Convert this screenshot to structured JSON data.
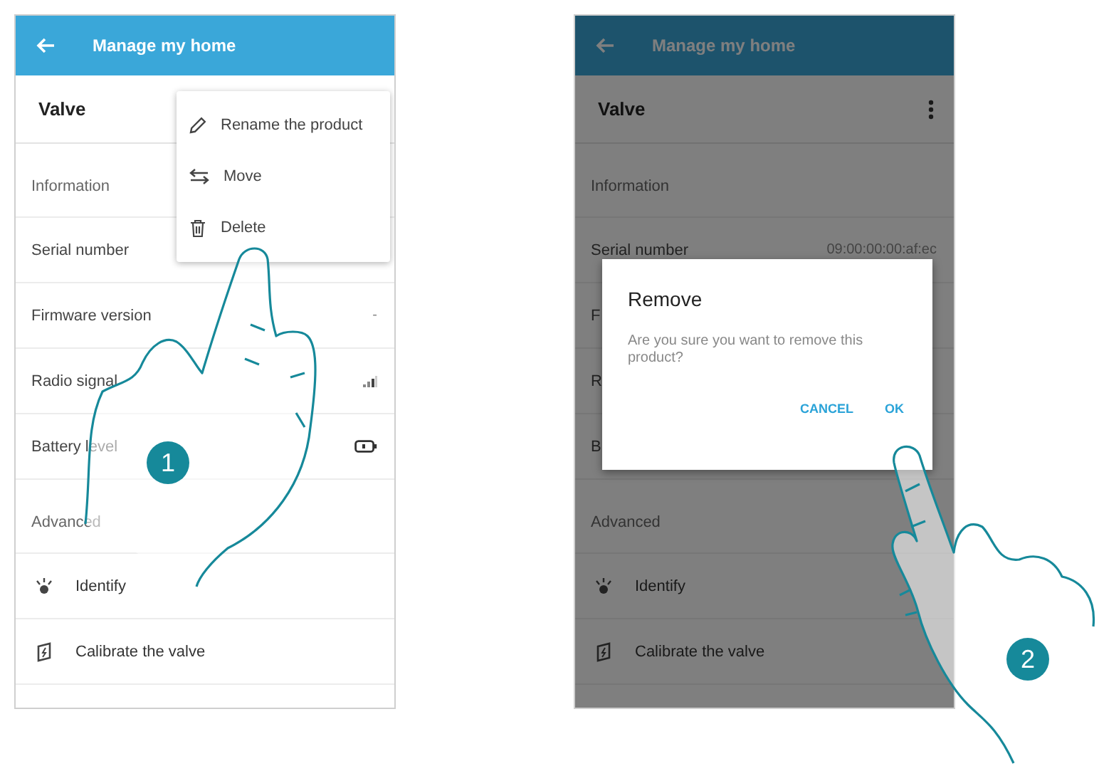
{
  "screens": [
    {
      "header": {
        "title": "Manage my home"
      },
      "product": "Valve",
      "dimmed": false,
      "rows": [
        {
          "kind": "section",
          "label": "Information"
        },
        {
          "kind": "text",
          "label": "Serial number"
        },
        {
          "kind": "text",
          "label": "Firmware version",
          "value": "-"
        },
        {
          "kind": "signal",
          "label": "Radio signal"
        },
        {
          "kind": "battery",
          "label": "Battery level"
        },
        {
          "kind": "section",
          "label": "Advanced"
        },
        {
          "kind": "identify",
          "label": "Identify"
        },
        {
          "kind": "calibrate",
          "label": "Calibrate the valve"
        }
      ],
      "menu": {
        "items": [
          {
            "kind": "rename",
            "label": "Rename the product"
          },
          {
            "kind": "move",
            "label": "Move"
          },
          {
            "kind": "delete",
            "label": "Delete"
          }
        ]
      },
      "step": "1"
    },
    {
      "header": {
        "title": "Manage my home"
      },
      "product": "Valve",
      "dimmed": true,
      "rows": [
        {
          "kind": "section",
          "label": "Information"
        },
        {
          "kind": "text",
          "label": "Serial number",
          "value": "09:00:00:00:af:ec"
        },
        {
          "kind": "text",
          "label": "F"
        },
        {
          "kind": "text",
          "label": "R"
        },
        {
          "kind": "text",
          "label": "B"
        },
        {
          "kind": "section",
          "label": "Advanced"
        },
        {
          "kind": "identify",
          "label": "Identify"
        },
        {
          "kind": "calibrate",
          "label": "Calibrate the valve"
        }
      ],
      "dialog": {
        "title": "Remove",
        "message": "Are you sure you want to remove this product?",
        "buttons": [
          "CANCEL",
          "OK"
        ]
      },
      "step": "2"
    }
  ]
}
